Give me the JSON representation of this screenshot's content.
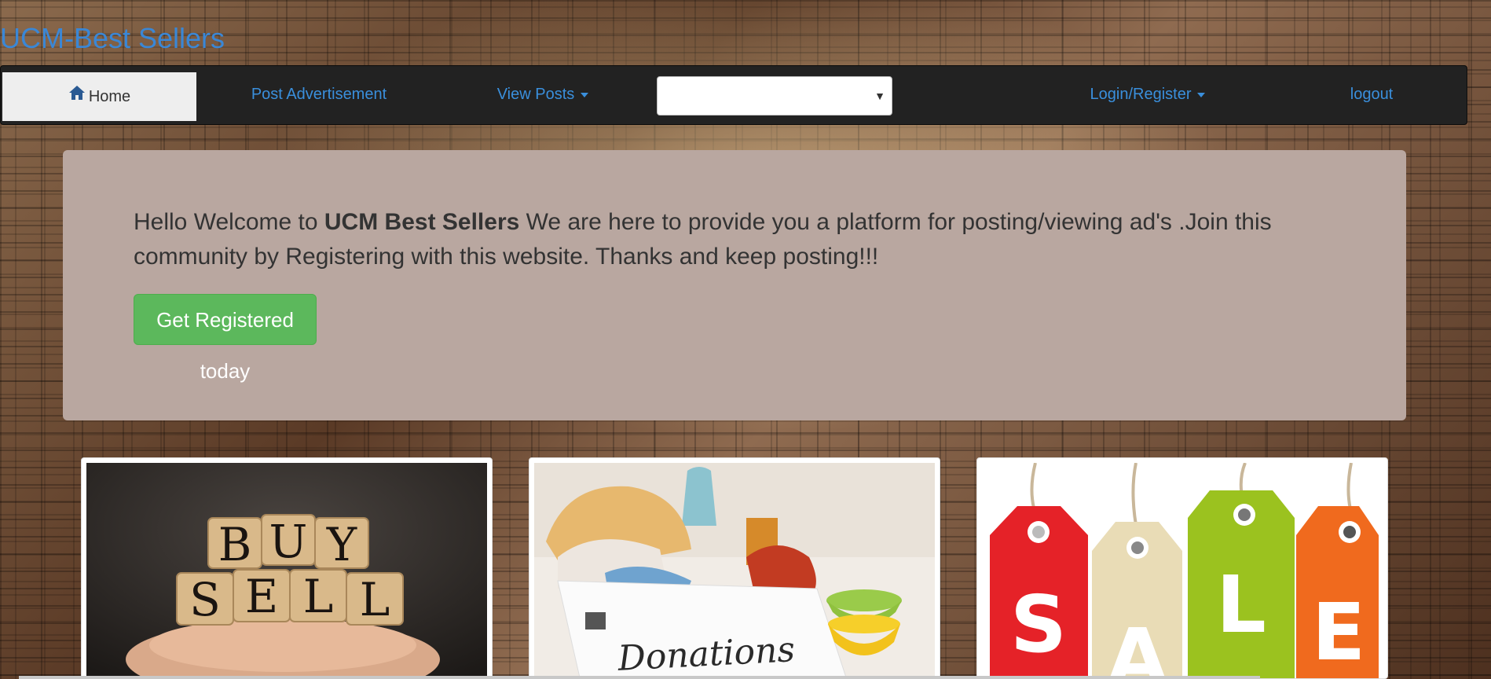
{
  "site": {
    "title": "UCM-Best Sellers"
  },
  "navbar": {
    "home": "Home",
    "post_ad": "Post Advertisement",
    "view_posts": "View Posts",
    "select_value": "",
    "login_register": "Login/Register",
    "logout": "logout"
  },
  "jumbotron": {
    "intro": "Hello Welcome to ",
    "brand": "UCM Best Sellers",
    "message": " We are here to provide you a platform for posting/viewing ad's .Join this community by Registering with this website. Thanks and keep posting!!!",
    "button": "Get Registered today"
  },
  "thumbnails": {
    "buy_sell": {
      "line1": "BUY",
      "line2": "SELL"
    },
    "donations": {
      "label": "Donations"
    },
    "sale": {
      "letters": [
        "S",
        "A",
        "L",
        "E"
      ]
    }
  },
  "colors": {
    "link": "#3a8fdc",
    "navbar_bg": "#222222",
    "jumbotron_bg": "#b9a7a0",
    "button_bg": "#5cb85c"
  },
  "icons": {
    "home": "home-icon",
    "dropdown": "caret-down-icon"
  }
}
